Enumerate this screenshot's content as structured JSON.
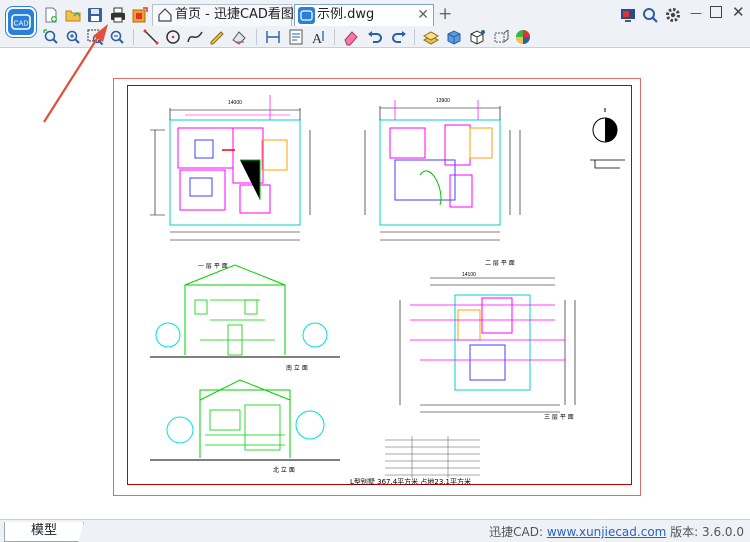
{
  "app": {
    "logo_text": "CAD",
    "tabs": [
      {
        "label": "首页 - 迅捷CAD看图",
        "icon": "home-icon",
        "active": false
      },
      {
        "label": "示例.dwg",
        "icon": "cad-file-icon",
        "active": true,
        "close": "✕"
      }
    ],
    "new_tab_glyph": "+"
  },
  "toolbar_top": [
    "new-file-icon",
    "open-file-icon",
    "save-icon",
    "print-icon",
    "export-icon"
  ],
  "toolbar_right": [
    "screen-icon",
    "search-icon",
    "gear-icon"
  ],
  "toolbar_second": [
    "zoom-window-icon",
    "zoom-in-icon",
    "zoom-extent-icon",
    "zoom-out-icon",
    "line-icon",
    "circle-icon",
    "spline-icon",
    "revcloud-icon",
    "rect-measure-icon",
    "sheet-icon",
    "text-icon",
    "eraser-icon",
    "undo-icon",
    "redo-icon",
    "layer-icon",
    "block-icon",
    "3d-view-icon",
    "color-wheel-icon"
  ],
  "drawing": {
    "plan1_title": "一 层 平 面",
    "plan2_title": "二 层 平 面",
    "plan3_title": "三 层 平 面",
    "elev1_title": "南 立 面",
    "elev2_title": "北 立 面",
    "summary": "L型别墅   367.4平方米   占地23.1平方米",
    "dim_top1": "14000",
    "dim_top2": "13900",
    "dim_top3": "14100"
  },
  "status": {
    "model_tab": "模型",
    "version_prefix": "迅捷CAD: ",
    "version_link": "www.xunjiecad.com",
    "version_suffix": " 版本: 3.6.0.0"
  },
  "colors": {
    "accent": "#2a7fd8",
    "sheet_border": "#c00000",
    "cad_green": "#00d000",
    "cad_magenta": "#ff00ff",
    "cad_cyan": "#00e0e0",
    "annotation_arrow": "#e0503a"
  }
}
